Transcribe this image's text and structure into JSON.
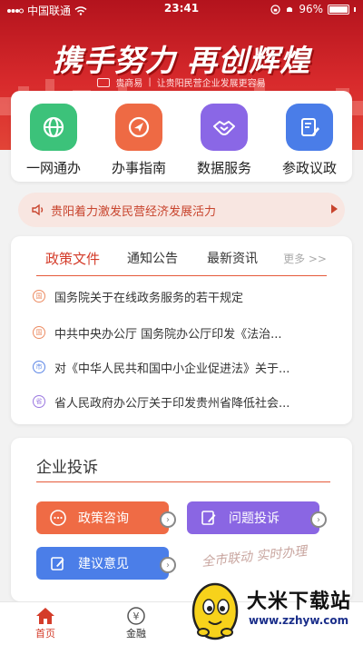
{
  "status_bar": {
    "carrier": "中国联通",
    "time": "23:41",
    "battery": "96%"
  },
  "hero": {
    "slogan": "携手努力 再创辉煌",
    "subtitle_left": "贵商易",
    "subtitle_right": "让贵阳民营企业发展更容易"
  },
  "services": [
    {
      "label": "一网通办",
      "icon": "globe-icon",
      "color": "#3cc27a"
    },
    {
      "label": "办事指南",
      "icon": "navigation-icon",
      "color": "#ee6a44"
    },
    {
      "label": "数据服务",
      "icon": "handshake-icon",
      "color": "#8a67e6"
    },
    {
      "label": "参政议政",
      "icon": "document-edit-icon",
      "color": "#4a7de8"
    }
  ],
  "ticker": {
    "text": "贵阳着力激发民营经济发展活力"
  },
  "news": {
    "tabs": [
      "政策文件",
      "通知公告",
      "最新资讯"
    ],
    "active_tab": "政策文件",
    "more": "更多 >>",
    "items": [
      {
        "text": "国务院关于在线政务服务的若干规定",
        "icon_color": "#ec8b62"
      },
      {
        "text": "中共中央办公厅 国务院办公厅印发《法治...",
        "icon_color": "#ec8b62"
      },
      {
        "text": "对《中华人民共和国中小企业促进法》关于...",
        "icon_color": "#5c86e6"
      },
      {
        "text": "省人民政府办公厅关于印发贵州省降低社会...",
        "icon_color": "#9a77e0"
      }
    ]
  },
  "complaint": {
    "title": "企业投诉",
    "buttons": [
      {
        "label": "政策咨询",
        "color": "#ef6b45"
      },
      {
        "label": "问题投诉",
        "color": "#8a66e3"
      },
      {
        "label": "建议意见",
        "color": "#4b7ee8"
      }
    ],
    "seal_text": "全市联动 实时办理"
  },
  "bottom_nav": [
    {
      "label": "首页",
      "active": true
    },
    {
      "label": "金融",
      "active": false
    }
  ],
  "watermark": {
    "title": "大米下载站",
    "url": "www.zzhyw.com"
  },
  "colors": {
    "brand_red": "#d43c2a",
    "hero_top": "#b3131d"
  }
}
